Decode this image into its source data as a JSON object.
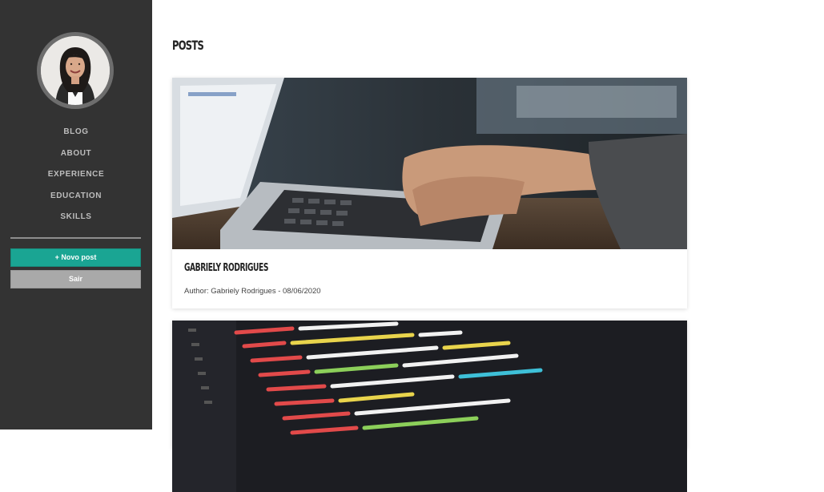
{
  "sidebar": {
    "avatar_alt": "profile photo",
    "nav": [
      "BLOG",
      "ABOUT",
      "EXPERIENCE",
      "EDUCATION",
      "SKILLS"
    ],
    "new_post_label": "+ Novo post",
    "logout_label": "Sair"
  },
  "main": {
    "title": "POSTS",
    "posts": [
      {
        "title": "GABRIELY RODRIGUES",
        "meta": "Author: Gabriely Rodrigues - 08/06/2020",
        "image": "laptop typing photo"
      },
      {
        "title": "",
        "meta": "",
        "image": "code on screen photo"
      }
    ]
  },
  "colors": {
    "sidebar_bg": "#333333",
    "accent": "#1aa593",
    "logout_bg": "#a9a9a9"
  }
}
